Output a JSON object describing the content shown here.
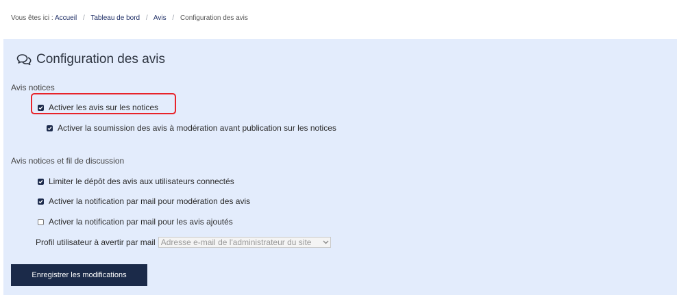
{
  "breadcrumb": {
    "prefix": "Vous êtes ici :",
    "items": [
      "Accueil",
      "Tableau de bord",
      "Avis"
    ],
    "current": "Configuration des avis",
    "separator": "/"
  },
  "page": {
    "title": "Configuration des avis",
    "title_icon": "comments-icon"
  },
  "sections": {
    "avis_notices": {
      "label": "Avis notices",
      "options": [
        {
          "label": "Activer les avis sur les notices",
          "checked": true
        },
        {
          "label": "Activer la soumission des avis à modération avant publication sur les notices",
          "checked": true
        }
      ]
    },
    "avis_fil": {
      "label": "Avis notices et fil de discussion",
      "options": [
        {
          "label": "Limiter le dépôt des avis aux utilisateurs connectés",
          "checked": true
        },
        {
          "label": "Activer la notification par mail pour modération des avis",
          "checked": true
        },
        {
          "label": "Activer la notification par mail pour les avis ajoutés",
          "checked": false
        }
      ]
    }
  },
  "profile": {
    "label": "Profil utilisateur à avertir par mail",
    "selected": "Adresse e-mail de l'administrateur du site"
  },
  "save_button": {
    "label": "Enregistrer les modifications"
  },
  "colors": {
    "panel_bg": "#e3ecfc",
    "button_bg": "#1b2a49",
    "highlight": "#e8232a",
    "link": "#1f2f66"
  }
}
